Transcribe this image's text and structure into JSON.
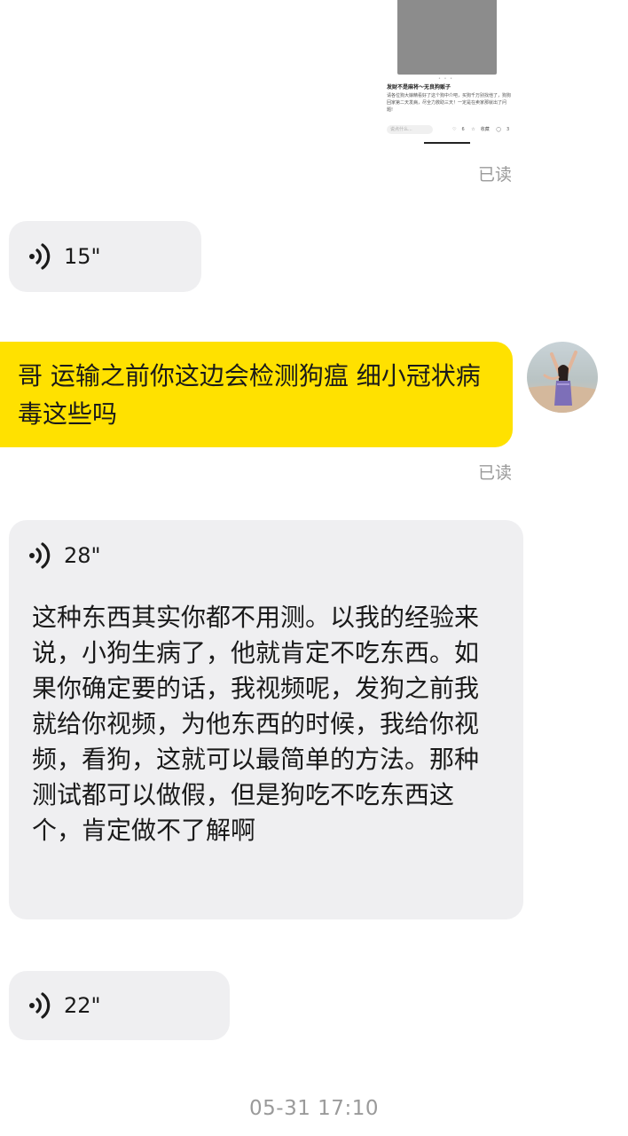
{
  "shared_post": {
    "title": "发财不是麻将～无良狗贩子",
    "body": "请各位狗大娘精看好了这个狗中介吧，买狗千万别找他了，狗狗回家第二天发病，尽全力救助三天！一定是在卖家那就出了问题!",
    "page_dots": "• • •",
    "comment_placeholder": "说点什么...",
    "likes": "6",
    "favorite_label": "收藏",
    "comments": "3"
  },
  "messages": {
    "read_label_1": "已读",
    "voice_1_duration": "15\"",
    "outgoing_text": "哥 运输之前你这边会检测狗瘟 细小冠状病毒这些吗",
    "read_label_2": "已读",
    "voice_2_duration": "28\"",
    "voice_2_transcript": "这种东西其实你都不用测。以我的经验来说，小狗生病了，他就肯定不吃东西。如果你确定要的话，我视频呢，发狗之前我就给你视频，为他东西的时候，我给你视频，看狗，这就可以最简单的方法。那种测试都可以做假，但是狗吃不吃东西这个，肯定做不了解啊",
    "voice_3_duration": "22\""
  },
  "timestamp": "05-31 17:10",
  "icons": {
    "voice": "voice-wave-icon",
    "like": "heart-icon",
    "favorite": "star-icon",
    "comment": "comment-icon"
  },
  "colors": {
    "outgoing_bubble": "#ffe100",
    "incoming_bubble": "#efeff1",
    "muted_text": "#9a9a9a"
  }
}
